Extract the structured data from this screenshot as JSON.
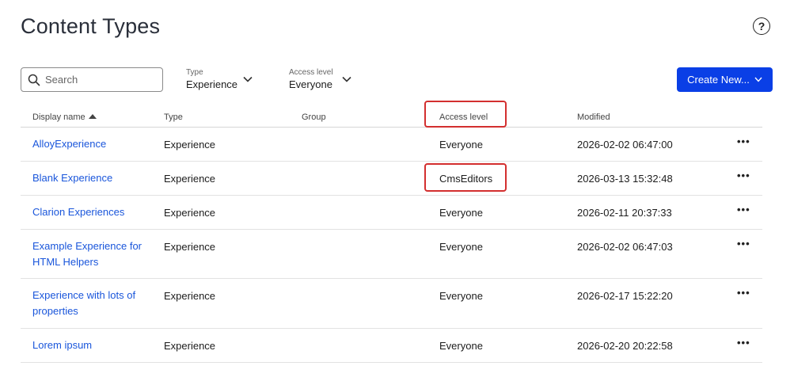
{
  "header": {
    "title": "Content Types",
    "help_icon": "question-circle-icon"
  },
  "toolbar": {
    "search_placeholder": "Search",
    "type_filter": {
      "label": "Type",
      "value": "Experience"
    },
    "access_filter": {
      "label": "Access level",
      "value": "Everyone"
    },
    "create_label": "Create New..."
  },
  "table": {
    "columns": {
      "display_name": "Display name",
      "type": "Type",
      "group": "Group",
      "access_level": "Access level",
      "modified": "Modified"
    },
    "sort": {
      "column": "Display name",
      "direction": "ascending"
    },
    "rows": [
      {
        "name": "AlloyExperience",
        "type": "Experience",
        "group": "",
        "access": "Everyone",
        "modified": "2026-02-02 06:47:00",
        "more": "•••"
      },
      {
        "name": "Blank Experience",
        "type": "Experience",
        "group": "",
        "access": "CmsEditors",
        "modified": "2026-03-13 15:32:48",
        "more": "•••"
      },
      {
        "name": "Clarion Experiences",
        "type": "Experience",
        "group": "",
        "access": "Everyone",
        "modified": "2026-02-11 20:37:33",
        "more": "•••"
      },
      {
        "name": "Example Experience for HTML Helpers",
        "type": "Experience",
        "group": "",
        "access": "Everyone",
        "modified": "2026-02-02 06:47:03",
        "more": "•••"
      },
      {
        "name": "Experience with lots of properties",
        "type": "Experience",
        "group": "",
        "access": "Everyone",
        "modified": "2026-02-17 15:22:20",
        "more": "•••"
      },
      {
        "name": "Lorem ipsum",
        "type": "Experience",
        "group": "",
        "access": "Everyone",
        "modified": "2026-02-20 20:22:58",
        "more": "•••"
      }
    ]
  },
  "colors": {
    "accent": "#0a3fe6",
    "link": "#1a56db",
    "highlight": "#d32f2f"
  }
}
